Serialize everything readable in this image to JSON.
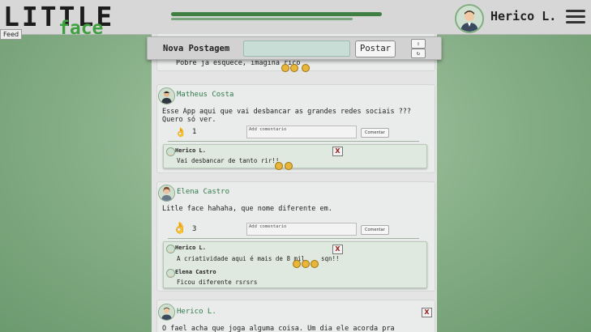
{
  "header": {
    "logo_main": "LITTLE",
    "logo_accent": "face",
    "feed_tab": "Feed",
    "user_name": "Herico L."
  },
  "new_post": {
    "label": "Nova Postagem",
    "submit_label": "Postar",
    "upload_icon": "⇪",
    "refresh_icon": "↻"
  },
  "posts": [
    {
      "text": "Pobre ja esquece, imagina rico"
    },
    {
      "author": "Matheus Costa",
      "text": "Esse App aqui que vai desbancar as grandes redes sociais ??? Quero só ver.",
      "likes": "1",
      "comment_placeholder": "Add comentario",
      "comment_button": "Comentar",
      "comments": [
        {
          "author": "Herico L.",
          "text": "Vai desbancar de tanto rir!!"
        }
      ]
    },
    {
      "author": "Elena Castro",
      "text": "Litle face hahaha, que nome diferente em.",
      "likes": "3",
      "comment_placeholder": "Add comentario",
      "comment_button": "Comentar",
      "comments": [
        {
          "author": "Herico L.",
          "text": "A criatividade aqui é mais de 8 mil",
          "suffix": "sqn!!"
        },
        {
          "author": "Elena Castro",
          "text": "Ficou diferente rsrsrs"
        }
      ]
    },
    {
      "author": "Herico L.",
      "text": "O fael acha que joga alguma coisa. Um dia ele acorda pra realidade..."
    }
  ],
  "delete_label": "X",
  "icons": {
    "menu": "hamburger-menu-icon",
    "like": "hand-like-icon",
    "emoji": "smiley-icon"
  },
  "colors": {
    "accent": "#3fa040",
    "background": "#84ad85",
    "author": "#2e7a4a"
  }
}
